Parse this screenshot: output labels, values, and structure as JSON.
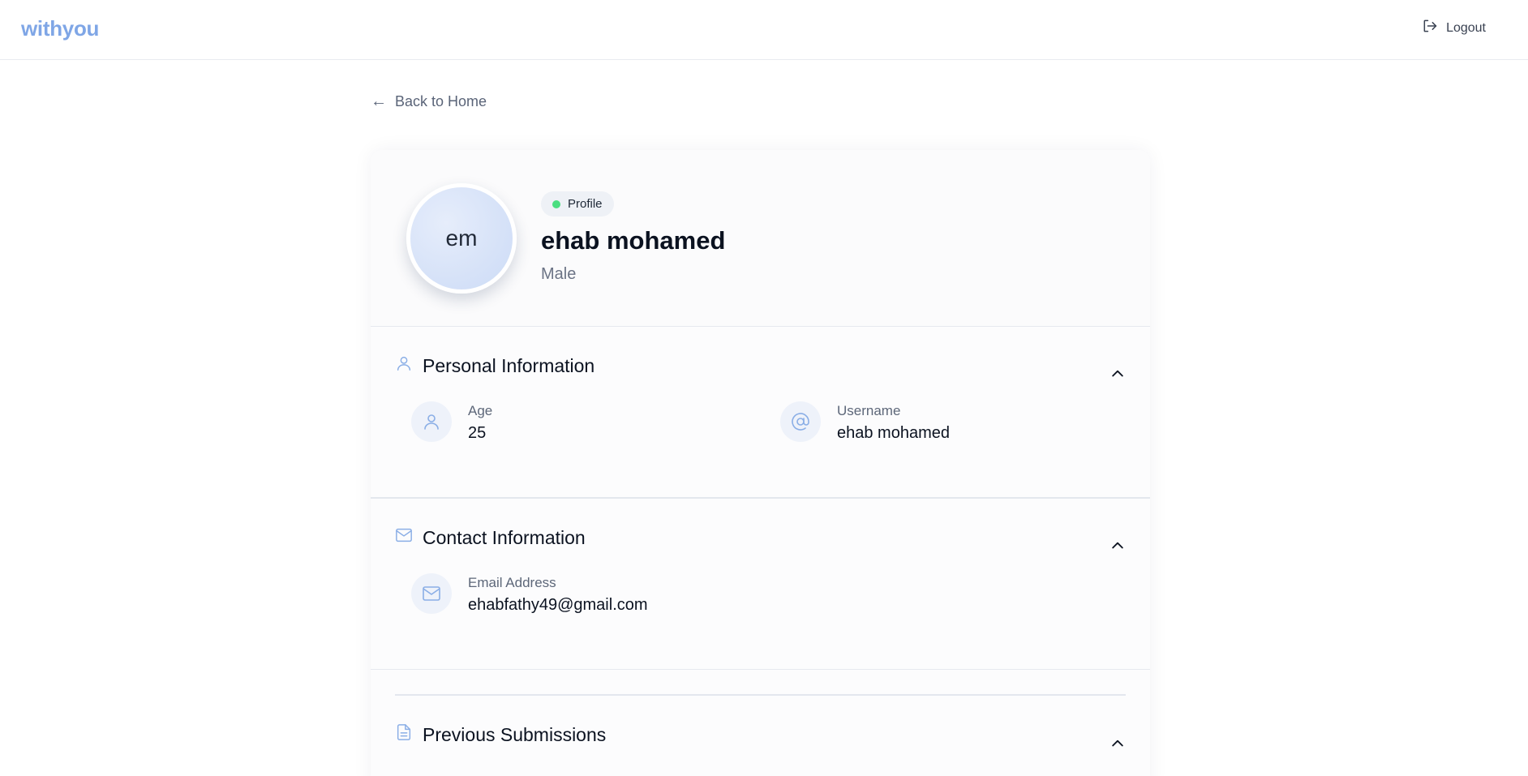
{
  "header": {
    "brand": "withyou",
    "logout_label": "Logout"
  },
  "nav": {
    "back_label": "Back to Home"
  },
  "profile": {
    "initials": "em",
    "badge_label": "Profile",
    "name": "ehab mohamed",
    "gender": "Male"
  },
  "sections": {
    "personal": {
      "title": "Personal Information",
      "age_label": "Age",
      "age_value": "25",
      "username_label": "Username",
      "username_value": "ehab mohamed"
    },
    "contact": {
      "title": "Contact Information",
      "email_label": "Email Address",
      "email_value": "ehabfathy49@gmail.com"
    },
    "previous": {
      "title": "Previous Submissions"
    }
  },
  "colors": {
    "brand": "#7fa6e6",
    "accent_icon": "#8aaee6",
    "status_dot": "#4ade80"
  },
  "icons": {
    "logout": "logout-icon",
    "back": "arrow-left-icon",
    "personal": "user-icon",
    "age": "user-icon",
    "username": "at-sign-icon",
    "contact": "mail-icon",
    "email": "mail-icon",
    "previous": "document-icon",
    "collapse": "chevron-up-icon"
  }
}
